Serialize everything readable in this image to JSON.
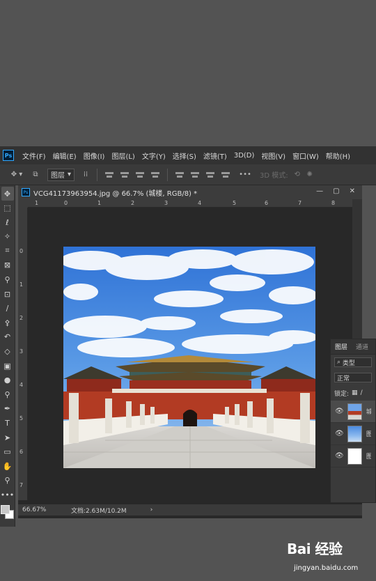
{
  "app": {
    "logo_text": "Ps"
  },
  "menu": {
    "items": [
      "文件(F)",
      "编辑(E)",
      "图像(I)",
      "图层(L)",
      "文字(Y)",
      "选择(S)",
      "滤镜(T)",
      "3D(D)",
      "视图(V)",
      "窗口(W)",
      "帮助(H)"
    ]
  },
  "options_bar": {
    "layer_select": "图层",
    "three_d_mode": "3D 模式:"
  },
  "tools": [
    "move-tool",
    "marquee-tool",
    "lasso-tool",
    "magic-wand-tool",
    "crop-tool",
    "frame-tool",
    "eyedropper-tool",
    "spot-healing-tool",
    "brush-tool",
    "clone-stamp-tool",
    "history-brush-tool",
    "eraser-tool",
    "gradient-tool",
    "blur-tool",
    "dodge-tool",
    "pen-tool",
    "type-tool",
    "path-selection-tool",
    "rectangle-tool",
    "hand-tool",
    "zoom-tool",
    "more-tools"
  ],
  "document": {
    "title": "VCG41173963954.jpg @ 66.7% (城楼, RGB/8) *",
    "zoom": "66.67%",
    "doc_size": "文档:2.63M/10.2M",
    "ruler_top_labels": [
      "1",
      "0",
      "1",
      "2",
      "3",
      "4",
      "5",
      "6",
      "7",
      "8"
    ],
    "ruler_left_labels": [
      "0",
      "1",
      "2",
      "3",
      "4",
      "5",
      "6",
      "7"
    ]
  },
  "layers_panel": {
    "tabs": [
      "图层",
      "通道"
    ],
    "filter_label": "类型",
    "blend_mode": "正常",
    "lock_label": "锁定:",
    "layers": [
      {
        "name": "城",
        "selected": true
      },
      {
        "name": "图",
        "selected": false
      },
      {
        "name": "图",
        "selected": false
      }
    ]
  },
  "watermark": {
    "main": "Bai 经验",
    "sub": "jingyan.baidu.com"
  },
  "colors": {
    "workspace": "#535353",
    "menubar": "#323232",
    "canvas_bg": "#282828",
    "accent": "#31a8ff"
  }
}
